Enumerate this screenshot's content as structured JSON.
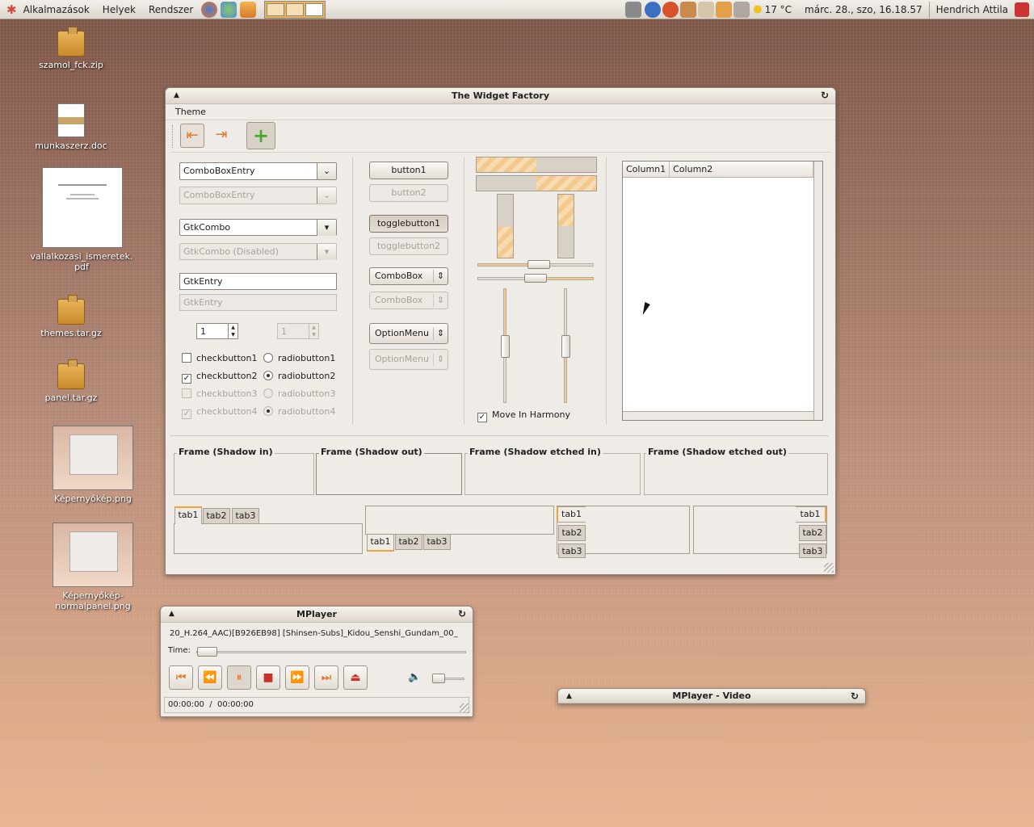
{
  "panel": {
    "menus": [
      "Alkalmazások",
      "Helyek",
      "Rendszer"
    ],
    "weather": "17 °C",
    "clock": "márc. 28., szo, 16.18.57",
    "user": "Hendrich Attila"
  },
  "desktop": {
    "icons": [
      {
        "label": "szamol_fck.zip",
        "icon": "archive-icon"
      },
      {
        "label": "munkaszerz.doc",
        "icon": "document-icon"
      },
      {
        "label": "vallalkozasi_ismeretek.pdf",
        "icon": "pdf-icon"
      },
      {
        "label": "themes.tar.gz",
        "icon": "archive-icon"
      },
      {
        "label": "panel.tar.gz",
        "icon": "archive-icon"
      },
      {
        "label": "Képernyőkép.png",
        "icon": "image-icon"
      },
      {
        "label": "Képernyőkép-normalpanel.png",
        "icon": "image-icon"
      }
    ]
  },
  "widget_factory": {
    "title": "The Widget Factory",
    "menu": "Theme",
    "col1": {
      "combo1": "ComboBoxEntry",
      "combo1_dis": "ComboBoxEntry",
      "gtkcombo": "GtkCombo",
      "gtkcombo_dis": "GtkCombo (Disabled)",
      "entry": "GtkEntry",
      "entry_dis": "GtkEntry",
      "spin": "1",
      "spin_dis": "1",
      "check1": "checkbutton1",
      "check2": "checkbutton2",
      "check3": "checkbutton3",
      "check4": "checkbutton4",
      "radio1": "radiobutton1",
      "radio2": "radiobutton2",
      "radio3": "radiobutton3",
      "radio4": "radiobutton4"
    },
    "col2": {
      "button1": "button1",
      "button2": "button2",
      "toggle1": "togglebutton1",
      "toggle2": "togglebutton2",
      "combobox": "ComboBox",
      "combobox_dis": "ComboBox",
      "optionmenu": "OptionMenu",
      "optionmenu_dis": "OptionMenu"
    },
    "col3": {
      "harmony": "Move In Harmony",
      "progress": [
        0.5,
        0.5,
        0.5,
        0.5
      ]
    },
    "tree": {
      "columns": [
        "Column1",
        "Column2"
      ]
    },
    "frames": [
      "Frame (Shadow in)",
      "Frame (Shadow out)",
      "Frame (Shadow etched in)",
      "Frame (Shadow etched out)"
    ],
    "tabs": [
      "tab1",
      "tab2",
      "tab3"
    ]
  },
  "mplayer": {
    "title": "MPlayer",
    "file": "20_H.264_AAC)[B926EB98] [Shinsen-Subs]_Kidou_Senshi_Gundam_00_",
    "time_label": "Time:",
    "status": "00:00:00  /  00:00:00"
  },
  "mplayer_video": {
    "title": "MPlayer - Video"
  }
}
